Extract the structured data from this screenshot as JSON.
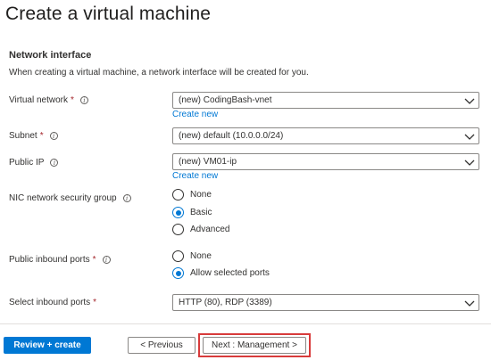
{
  "header": {
    "title": "Create a virtual machine",
    "more": "···"
  },
  "section": {
    "title": "Network interface",
    "description": "When creating a virtual machine, a network interface will be created for you."
  },
  "fields": {
    "virtual_network": {
      "label": "Virtual network",
      "required": "*",
      "value": "(new) CodingBash-vnet",
      "create_new": "Create new"
    },
    "subnet": {
      "label": "Subnet",
      "required": "*",
      "value": "(new) default (10.0.0.0/24)"
    },
    "public_ip": {
      "label": "Public IP",
      "value": "(new) VM01-ip",
      "create_new": "Create new"
    },
    "nsg": {
      "label": "NIC network security group",
      "options": [
        "None",
        "Basic",
        "Advanced"
      ],
      "selected": "Basic"
    },
    "inbound_ports": {
      "label": "Public inbound ports",
      "required": "*",
      "options": [
        "None",
        "Allow selected ports"
      ],
      "selected": "Allow selected ports"
    },
    "select_ports": {
      "label": "Select inbound ports",
      "required": "*",
      "value": "HTTP (80), RDP (3389)"
    }
  },
  "footer": {
    "review_create": "Review + create",
    "previous": "< Previous",
    "next": "Next : Management >"
  },
  "colors": {
    "accent": "#0078d4",
    "required": "#a4262c",
    "highlight": "#d83b3b"
  },
  "icons": {
    "info": "info-icon",
    "chevron": "chevron-down-icon",
    "more": "ellipsis-icon"
  }
}
